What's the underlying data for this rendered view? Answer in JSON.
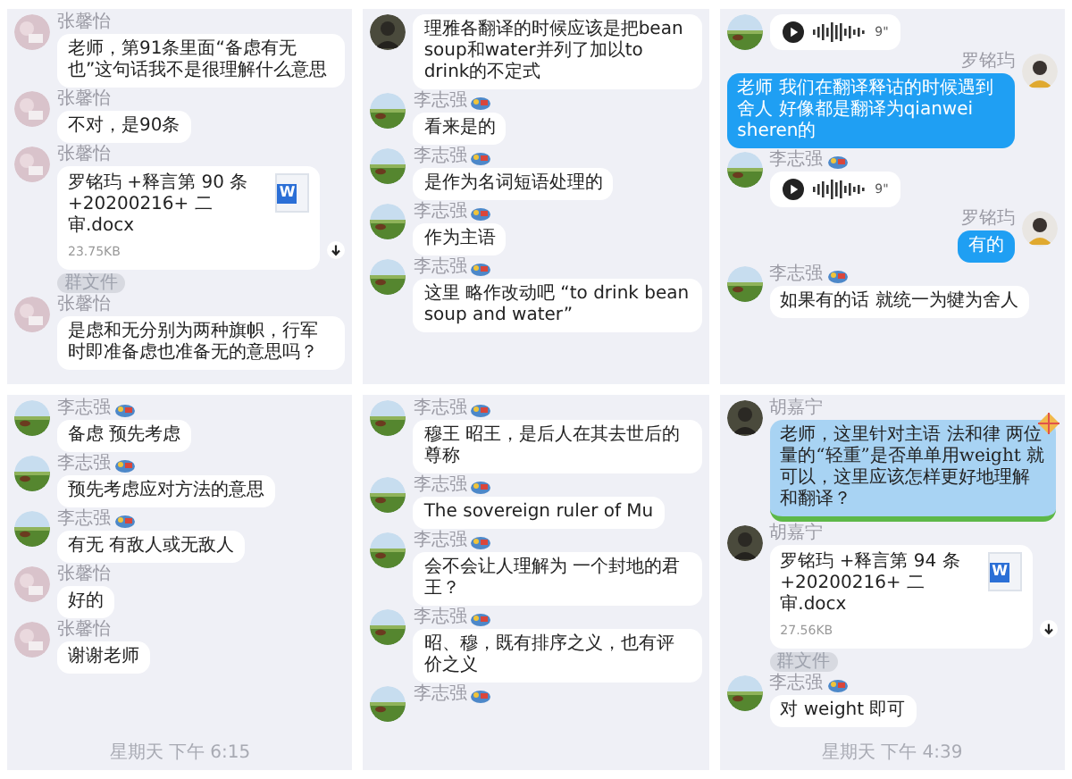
{
  "panels": [
    {
      "items": [
        {
          "kind": "text",
          "outgoing": false,
          "sender": "张馨怡",
          "avatar": {
            "kind": "pink"
          },
          "badge": false,
          "text": "老师，第91条里面“备虑有无也”这句话我不是很理解什么意思"
        },
        {
          "kind": "text",
          "outgoing": false,
          "sender": "张馨怡",
          "avatar": {
            "kind": "pink"
          },
          "badge": false,
          "text": "不对，是90条"
        },
        {
          "kind": "file",
          "outgoing": false,
          "sender": "张馨怡",
          "avatar": {
            "kind": "pink"
          },
          "badge": false,
          "title": "罗铭玙 +释言第 90 条 +20200216+ 二审.docx",
          "size": "23.75KB",
          "file_letter": "W",
          "downloadable": true
        },
        {
          "kind": "tag",
          "text": "群文件"
        },
        {
          "kind": "text",
          "outgoing": false,
          "sender": "张馨怡",
          "avatar": {
            "kind": "pink"
          },
          "badge": false,
          "text": "是虑和无分别为两种旗帜，行军时即准备虑也准备无的意思吗？"
        }
      ]
    },
    {
      "items": [
        {
          "kind": "text",
          "outgoing": false,
          "avatar": {
            "kind": "dark"
          },
          "text": "理雅各翻译的时候应该是把bean soup和water并列了加以to drink的不定式"
        },
        {
          "kind": "text",
          "outgoing": false,
          "sender": "李志强",
          "avatar": {
            "kind": "field"
          },
          "badge": true,
          "text": "看来是的"
        },
        {
          "kind": "text",
          "outgoing": false,
          "sender": "李志强",
          "avatar": {
            "kind": "field"
          },
          "badge": true,
          "text": "是作为名词短语处理的"
        },
        {
          "kind": "text",
          "outgoing": false,
          "sender": "李志强",
          "avatar": {
            "kind": "field"
          },
          "badge": true,
          "text": "作为主语"
        },
        {
          "kind": "text",
          "outgoing": false,
          "sender": "李志强",
          "avatar": {
            "kind": "field"
          },
          "badge": true,
          "text": "这里 略作改动吧 “to drink bean soup and water”"
        }
      ]
    },
    {
      "items": [
        {
          "kind": "voice",
          "outgoing": false,
          "avatar": {
            "kind": "field"
          },
          "duration": "9\""
        },
        {
          "kind": "text",
          "outgoing": true,
          "sender": "罗铭玙",
          "avatar": {
            "kind": "glasses"
          },
          "badge": false,
          "text": "老师 我们在翻译释诂的时候遇到舍人 好像都是翻译为qianwei sheren的"
        },
        {
          "kind": "voice",
          "outgoing": false,
          "sender": "李志强",
          "avatar": {
            "kind": "field"
          },
          "badge": true,
          "duration": "9\""
        },
        {
          "kind": "text",
          "outgoing": true,
          "sender": "罗铭玙",
          "avatar": {
            "kind": "glasses"
          },
          "badge": false,
          "text": "有的"
        },
        {
          "kind": "text",
          "outgoing": false,
          "sender": "李志强",
          "avatar": {
            "kind": "field"
          },
          "badge": true,
          "text": "如果有的话 就统一为犍为舍人"
        }
      ]
    },
    {
      "items": [
        {
          "kind": "text",
          "outgoing": false,
          "sender": "李志强",
          "avatar": {
            "kind": "field"
          },
          "badge": true,
          "text": "备虑 预先考虑"
        },
        {
          "kind": "text",
          "outgoing": false,
          "sender": "李志强",
          "avatar": {
            "kind": "field"
          },
          "badge": true,
          "text": "预先考虑应对方法的意思"
        },
        {
          "kind": "text",
          "outgoing": false,
          "sender": "李志强",
          "avatar": {
            "kind": "field"
          },
          "badge": true,
          "text": "有无 有敌人或无敌人"
        },
        {
          "kind": "text",
          "outgoing": false,
          "sender": "张馨怡",
          "avatar": {
            "kind": "pink"
          },
          "badge": false,
          "text": "好的"
        },
        {
          "kind": "text",
          "outgoing": false,
          "sender": "张馨怡",
          "avatar": {
            "kind": "pink"
          },
          "badge": false,
          "text": "谢谢老师"
        },
        {
          "kind": "time",
          "text": "星期天 下午 6:15"
        }
      ]
    },
    {
      "items": [
        {
          "kind": "text",
          "outgoing": false,
          "sender": "李志强",
          "avatar": {
            "kind": "field"
          },
          "badge": true,
          "text": "穆王 昭王，是后人在其去世后的尊称"
        },
        {
          "kind": "text",
          "outgoing": false,
          "sender": "李志强",
          "avatar": {
            "kind": "field"
          },
          "badge": true,
          "text": "The sovereign ruler of Mu"
        },
        {
          "kind": "text",
          "outgoing": false,
          "sender": "李志强",
          "avatar": {
            "kind": "field"
          },
          "badge": true,
          "text": "会不会让人理解为 一个封地的君王？"
        },
        {
          "kind": "text",
          "outgoing": false,
          "sender": "李志强",
          "avatar": {
            "kind": "field"
          },
          "badge": true,
          "text": "昭、穆，既有排序之义，也有评价之义"
        },
        {
          "kind": "stub",
          "outgoing": false,
          "sender": "李志强",
          "avatar": {
            "kind": "field"
          },
          "badge": true
        }
      ]
    },
    {
      "items": [
        {
          "kind": "themed",
          "outgoing": false,
          "sender": "胡嘉宁",
          "avatar": {
            "kind": "dark"
          },
          "badge": false,
          "text": "老师，这里针对主语 法和律 两位量的“轻重”是否单单用weight 就可以，这里应该怎样更好地理解和翻译？"
        },
        {
          "kind": "file",
          "outgoing": false,
          "sender": "胡嘉宁",
          "avatar": {
            "kind": "dark"
          },
          "badge": false,
          "title": "罗铭玙 +释言第 94 条 +20200216+ 二审.docx",
          "size": "27.56KB",
          "file_letter": "W",
          "downloadable": true
        },
        {
          "kind": "tag",
          "text": "群文件"
        },
        {
          "kind": "text",
          "outgoing": false,
          "sender": "李志强",
          "avatar": {
            "kind": "field"
          },
          "badge": true,
          "text": "对 weight 即可"
        },
        {
          "kind": "time",
          "text": "星期天 下午 4:39"
        }
      ]
    }
  ]
}
